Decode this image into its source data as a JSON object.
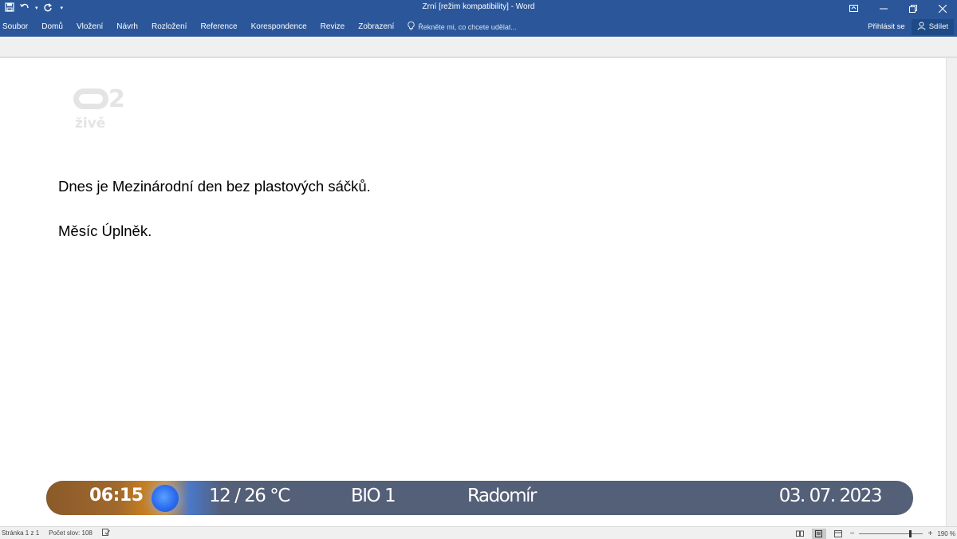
{
  "titlebar": {
    "title": "Zrní [režim kompatibility] - Word",
    "qat_icons": [
      "save-icon",
      "undo-icon",
      "redo-icon",
      "customize-qat-icon"
    ],
    "window_controls": [
      "ribbon-display-icon",
      "minimize-icon",
      "maximize-icon",
      "close-icon"
    ]
  },
  "ribbon": {
    "tabs": [
      "Soubor",
      "Domů",
      "Vložení",
      "Návrh",
      "Rozložení",
      "Reference",
      "Korespondence",
      "Revize",
      "Zobrazení"
    ],
    "tell_me": "Řekněte mi, co chcete udělat...",
    "sign_in": "Přihlásit se",
    "share": "Sdílet"
  },
  "watermark": {
    "channel_number": "2",
    "channel_word": "živě"
  },
  "document": {
    "paragraphs": [
      "Dnes je Mezinárodní den bez plastových sáčků.",
      "Měsíc Úplněk."
    ]
  },
  "infobar": {
    "time": "06:15",
    "temperature": "12 / 26 °C",
    "program": "BIO 1",
    "name_day": "Radomír",
    "date": "03. 07. 2023"
  },
  "statusbar": {
    "page": "Stránka 1 z 1",
    "word_count": "Počet slov: 108",
    "zoom": "190 %",
    "zoom_level_percent": 190
  },
  "colors": {
    "ribbon": "#2b579a",
    "infobar": "#545f78",
    "time_accent": "#e2901c",
    "sun": "#2b6cf0"
  }
}
